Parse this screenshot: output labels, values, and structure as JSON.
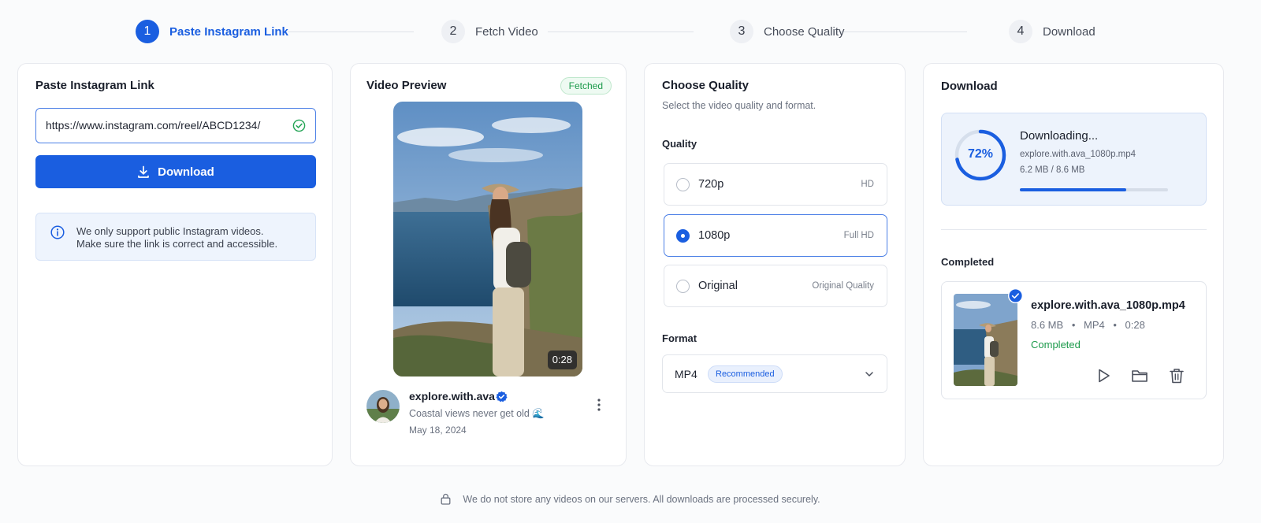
{
  "stepper": {
    "steps": [
      {
        "number": "1",
        "label": "Paste Instagram Link"
      },
      {
        "number": "2",
        "label": "Fetch Video"
      },
      {
        "number": "3",
        "label": "Choose Quality"
      },
      {
        "number": "4",
        "label": "Download"
      }
    ],
    "active_step": 1
  },
  "paste": {
    "title": "Paste Instagram Link",
    "url_value": "https://www.instagram.com/reel/ABCD1234/",
    "download_button": "Download",
    "info_line1": "We only support public Instagram videos.",
    "info_line2": "Make sure the link is correct and accessible."
  },
  "preview": {
    "title": "Video Preview",
    "status_badge": "Fetched",
    "duration": "0:28",
    "username": "explore.with.ava",
    "caption": "Coastal views never get old 🌊",
    "date": "May 18, 2024"
  },
  "quality": {
    "title": "Choose Quality",
    "subtitle": "Select the video quality and format.",
    "quality_label": "Quality",
    "options": [
      {
        "label": "720p",
        "tag": "HD",
        "selected": false
      },
      {
        "label": "1080p",
        "tag": "Full HD",
        "selected": true
      },
      {
        "label": "Original",
        "tag": "Original Quality",
        "selected": false
      }
    ],
    "format_label": "Format",
    "format_value": "MP4",
    "format_badge": "Recommended"
  },
  "download": {
    "title": "Download",
    "progress_percent": 72,
    "progress_text": "72%",
    "status": "Downloading...",
    "filename": "explore.with.ava_1080p.mp4",
    "size_text": "6.2 MB / 8.6 MB",
    "completed_label": "Completed",
    "completed_item": {
      "filename": "explore.with.ava_1080p.mp4",
      "size": "8.6 MB",
      "format": "MP4",
      "duration": "0:28",
      "status": "Completed"
    }
  },
  "footer": {
    "text": "We do not store any videos on our servers. All downloads are processed securely."
  },
  "colors": {
    "accent": "#1a5ee0",
    "success": "#1c9a4b",
    "muted_text": "#6b7280"
  }
}
